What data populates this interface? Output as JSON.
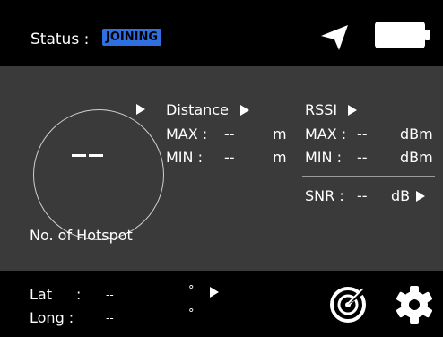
{
  "header": {
    "status_label": "Status :",
    "status_badge": "JOINING",
    "badge_color": "#2f6fe0",
    "location_icon": "navigation-arrow-icon",
    "battery_icon": "battery-icon"
  },
  "hotspot": {
    "count": "--",
    "label": "No. of Hotspot"
  },
  "distance": {
    "title": "Distance",
    "max_label": "MAX :",
    "max_value": "--",
    "min_label": "MIN :",
    "min_value": "--",
    "unit": "m"
  },
  "rssi": {
    "title": "RSSI",
    "max_label": "MAX :",
    "max_value": "--",
    "min_label": "MIN :",
    "min_value": "--",
    "unit": "dBm"
  },
  "snr": {
    "label": "SNR :",
    "value": "--",
    "unit": "dB"
  },
  "location": {
    "lat_label": "Lat",
    "lat_sep": ":",
    "lat_value": "--",
    "long_label": "Long :",
    "long_value": "--",
    "degree": "°"
  },
  "toolbar": {
    "radar_icon": "radar-icon",
    "settings_icon": "gear-icon"
  },
  "colors": {
    "panel_background": "#3a3a3a",
    "bar_background": "#000000"
  }
}
